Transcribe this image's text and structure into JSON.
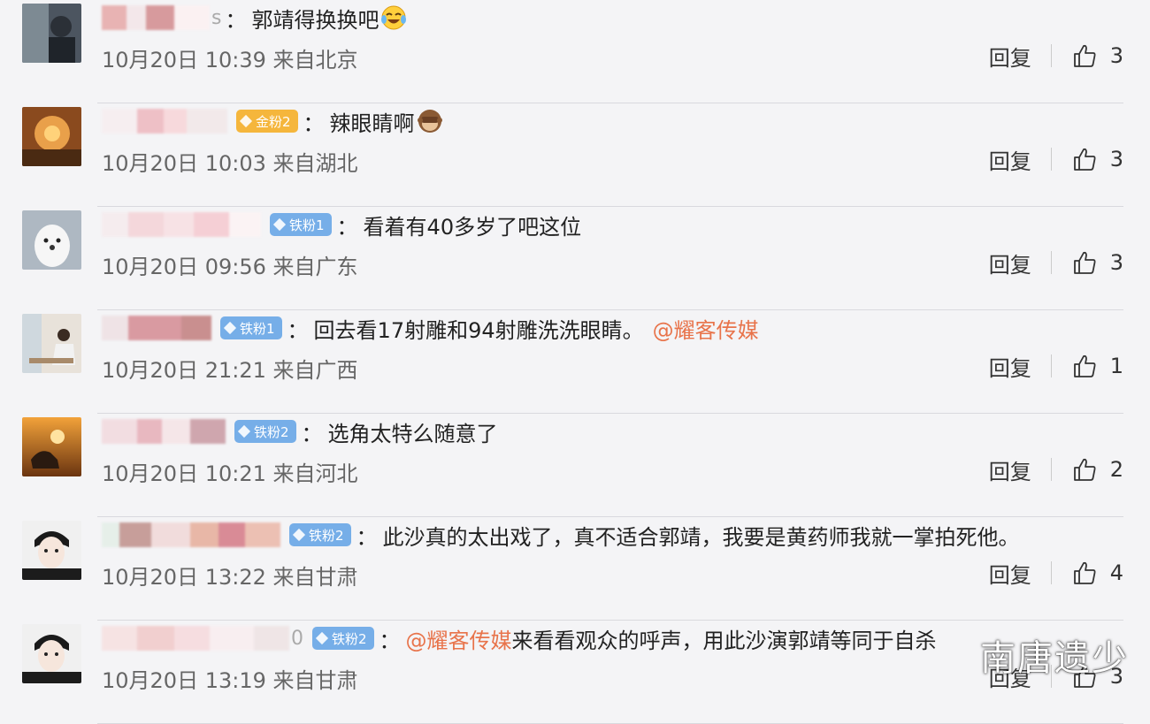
{
  "comments": [
    {
      "username_tail": "s",
      "badge": "",
      "text_mention": "",
      "text": "郭靖得换换吧",
      "emoji": "laughing-crying-emoji",
      "time": "10月20日 10:39 来自北京",
      "reply": "回复",
      "likes": "3",
      "blur_colors": [
        "#e8b3b3",
        "#f3e7ea",
        "#d79a9d",
        "#fbf1f2"
      ]
    },
    {
      "username_tail": "",
      "badge": "金粉2",
      "text_mention": "",
      "text": "辣眼睛啊",
      "emoji": "monkey-see-no-evil-emoji",
      "time": "10月20日 10:03 来自湖北",
      "reply": "回复",
      "likes": "3",
      "blur_colors": [
        "#f6eef0",
        "#eec0c6",
        "#f7d9dc",
        "#f2e9ea"
      ]
    },
    {
      "username_tail": "",
      "badge": "铁粉1",
      "text_mention": "",
      "text": "看着有40多岁了吧这位",
      "emoji": "",
      "time": "10月20日 09:56 来自广东",
      "reply": "回复",
      "likes": "3",
      "blur_colors": [
        "#f5ecee",
        "#f4d7db",
        "#f7e2e5",
        "#f5cfd5",
        "#fbf3f4"
      ]
    },
    {
      "username_tail": "",
      "badge": "铁粉1",
      "text_mention": "",
      "text": "回去看17射雕和94射雕洗洗眼睛。",
      "text_after": "@耀客传媒",
      "emoji": "",
      "time": "10月20日 21:21 来自广西",
      "reply": "回复",
      "likes": "1",
      "blur_colors": [
        "#efe3e6",
        "#d99aa1",
        "#c98f8f"
      ]
    },
    {
      "username_tail": "",
      "badge": "铁粉2",
      "text_mention": "",
      "text": "选角太特么随意了",
      "emoji": "",
      "time": "10月20日 10:21 来自河北",
      "reply": "回复",
      "likes": "2",
      "blur_colors": [
        "#f2dde1",
        "#e8b8c0",
        "#f5e6e8",
        "#cfa6ae"
      ]
    },
    {
      "username_tail": "",
      "badge": "铁粉2",
      "text_mention": "",
      "text": "此沙真的太出戏了，真不适合郭靖，我要是黄药师我就一掌拍死他。",
      "emoji": "",
      "time": "10月20日 13:22 来自甘肃",
      "reply": "回复",
      "likes": "4",
      "blur_colors": [
        "#e6efe9",
        "#c79e9a",
        "#f1dcdc",
        "#e8b7a7",
        "#d98b96",
        "#ecc0b3"
      ]
    },
    {
      "username_tail": "0",
      "badge": "铁粉2",
      "text_mention": "@耀客传媒",
      "text": " 来看看观众的呼声，用此沙演郭靖等同于自杀",
      "emoji": "",
      "time": "10月20日 13:19 来自甘肃",
      "reply": "回复",
      "likes": "3",
      "blur_colors": [
        "#f6e3e3",
        "#f1cfcf",
        "#f6dde0",
        "#f8eef0",
        "#efe5e6"
      ]
    }
  ],
  "watermark": "南唐遗少"
}
